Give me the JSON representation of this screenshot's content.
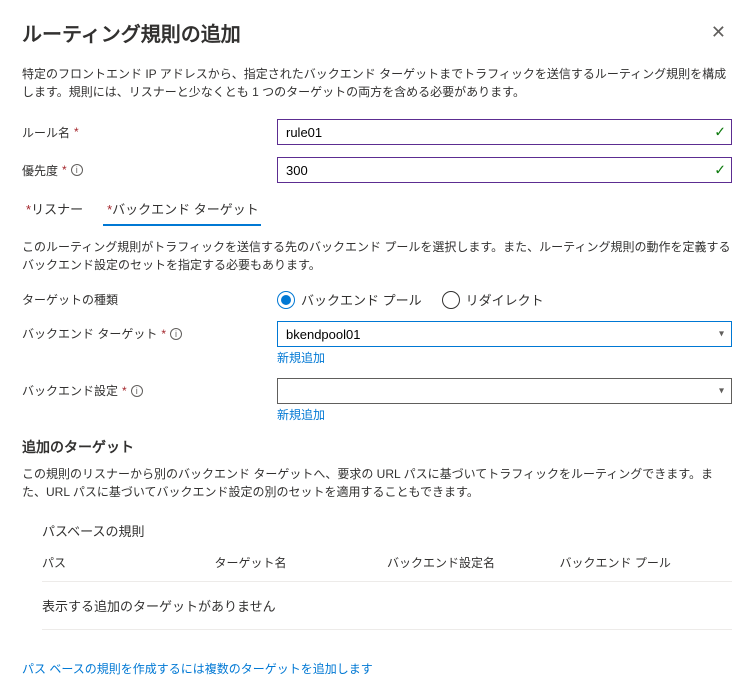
{
  "header": {
    "title": "ルーティング規則の追加",
    "close_aria": "Close"
  },
  "description": "特定のフロントエンド IP アドレスから、指定されたバックエンド ターゲットまでトラフィックを送信するルーティング規則を構成します。規則には、リスナーと少なくとも 1 つのターゲットの両方を含める必要があります。",
  "fields": {
    "ruleName": {
      "label": "ルール名",
      "value": "rule01"
    },
    "priority": {
      "label": "優先度",
      "value": "300"
    }
  },
  "tabs": {
    "listener": {
      "label": "リスナー"
    },
    "backend": {
      "label": "バックエンド ターゲット"
    }
  },
  "backend": {
    "description": "このルーティング規則がトラフィックを送信する先のバックエンド プールを選択します。また、ルーティング規則の動作を定義するバックエンド設定のセットを指定する必要もあります。",
    "targetType": {
      "label": "ターゲットの種類",
      "options": {
        "pool": "バックエンド プール",
        "redirect": "リダイレクト"
      },
      "selected": "pool"
    },
    "backendTarget": {
      "label": "バックエンド ターゲット",
      "value": "bkendpool01",
      "addNew": "新規追加"
    },
    "backendSetting": {
      "label": "バックエンド設定",
      "value": "",
      "addNew": "新規追加"
    }
  },
  "additional": {
    "heading": "追加のターゲット",
    "description": "この規則のリスナーから別のバックエンド ターゲットへ、要求の URL パスに基づいてトラフィックをルーティングできます。また、URL パスに基づいてバックエンド設定の別のセットを適用することもできます。",
    "pathTable": {
      "title": "パスベースの規則",
      "columns": {
        "path": "パス",
        "targetName": "ターゲット名",
        "settingName": "バックエンド設定名",
        "pool": "バックエンド プール"
      },
      "empty": "表示する追加のターゲットがありません"
    }
  },
  "bottomNote": "パス ベースの規則を作成するには複数のターゲットを追加します"
}
